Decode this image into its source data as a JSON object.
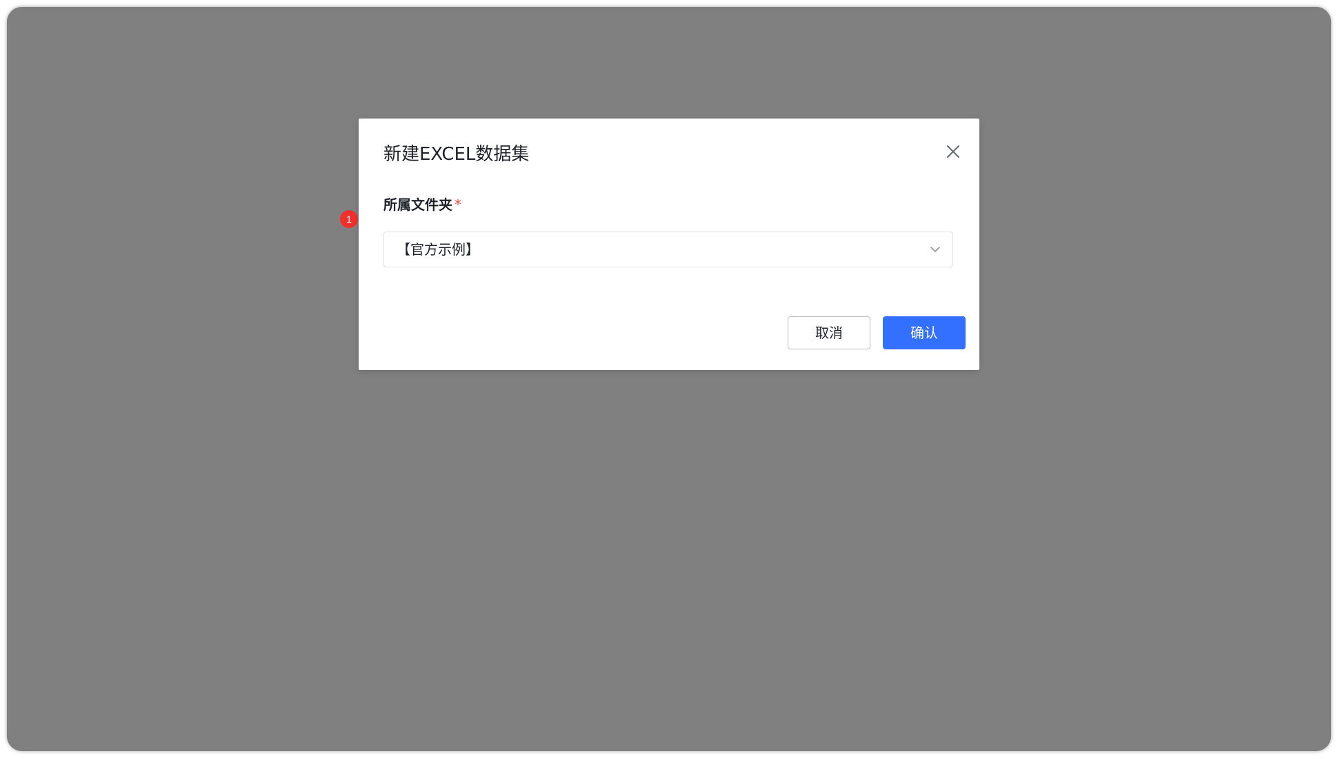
{
  "dialog": {
    "title": "新建EXCEL数据集",
    "close_icon": "close-icon",
    "folder_field": {
      "label": "所属文件夹",
      "required_mark": "*",
      "selected_value": "【官方示例】",
      "chevron_icon": "chevron-down-icon"
    },
    "buttons": {
      "cancel_label": "取消",
      "confirm_label": "确认"
    }
  },
  "annotation": {
    "step_number": "1"
  },
  "colors": {
    "overlay": "#808080",
    "primary": "#3370ff",
    "required": "#f54a45",
    "badge": "#f0302d"
  }
}
